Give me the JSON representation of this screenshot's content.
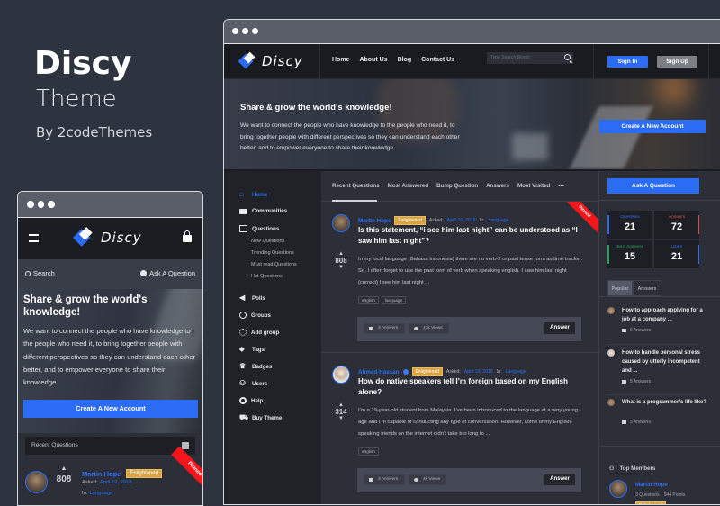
{
  "promo": {
    "title": "Discy",
    "subtitle": "Theme",
    "byline": "By 2codeThemes"
  },
  "brand": {
    "logo_text": "Discy",
    "accent": "#2c6cf5",
    "badge_color": "#d9a441",
    "pinned_color": "#f5151b"
  },
  "desktop": {
    "nav": {
      "menu": [
        "Home",
        "About Us",
        "Blog",
        "Contact Us"
      ],
      "search_placeholder": "Type Search Words",
      "sign_in": "Sign In",
      "sign_up": "Sign Up"
    },
    "hero": {
      "title": "Share & grow the world's knowledge!",
      "text": "We want to connect the people who have knowledge to the people who need it, to bring together people with different perspectives so they can understand each other better, and to empower everyone to share their knowledge.",
      "cta": "Create A New Account"
    },
    "sidebar": {
      "items": [
        {
          "label": "Home",
          "icon": "home-icon",
          "active": true
        },
        {
          "label": "Communities",
          "icon": "folder-icon"
        },
        {
          "label": "Questions",
          "icon": "book-icon"
        },
        {
          "label": "Polls",
          "icon": "megaphone-icon"
        },
        {
          "label": "Groups",
          "icon": "globe-icon"
        },
        {
          "label": "Add group",
          "icon": "add-group-icon"
        },
        {
          "label": "Tags",
          "icon": "tag-icon"
        },
        {
          "label": "Badges",
          "icon": "trophy-icon"
        },
        {
          "label": "Users",
          "icon": "users-icon"
        },
        {
          "label": "Help",
          "icon": "lifebuoy-icon"
        },
        {
          "label": "Buy Theme",
          "icon": "cart-icon"
        }
      ],
      "subitems": [
        "New Questions",
        "Trending Questions",
        "Must read Questions",
        "Hot Questions"
      ]
    },
    "tabs": [
      "Recent Questions",
      "Most Answered",
      "Bump Question",
      "Answers",
      "Most Visited",
      "•••"
    ],
    "questions": [
      {
        "author": "Martin Hope",
        "badge": "Enlightened",
        "asked_label": "Asked:",
        "date": "April 19, 2018",
        "in_label": "In:",
        "category": "Language",
        "title": "Is this statement, “i see him last night” can be understood as “I saw him last night”?",
        "body": "In my local language (Bahasa Indonesia) there are no verb-2 or past tense form as time tracker. So, I often forget to use the past form of verb when speaking english. I saw him last night (correct) I see him last night ...",
        "votes": "808",
        "tags": [
          "english",
          "language"
        ],
        "answers": "3 Answers",
        "views": "17k Views",
        "answer_button": "Answer",
        "pinned": "Pinned"
      },
      {
        "author": "Ahmed Hassan",
        "badge": "Enlightened",
        "asked_label": "Asked:",
        "date": "April 19, 2018",
        "in_label": "In:",
        "category": "Language",
        "title": "How do native speakers tell I’m foreign based on my English alone?",
        "body": "I’m a 19-year-old student from Malaysia. I’ve been introduced to the language at a very young age and I’m capable of conducting any type of conversation. However, some of my English-speaking friends on the internet didn’t take too long to ...",
        "votes": "314",
        "tags": [
          "english"
        ],
        "answers": "3 Answers",
        "views": "4k Views",
        "answer_button": "Answer"
      }
    ],
    "right": {
      "ask_button": "Ask A Question",
      "stats": [
        {
          "label": "Questions",
          "value": "21",
          "color": "#2c6cf5"
        },
        {
          "label": "Answers",
          "value": "72",
          "color": "#d9484d"
        },
        {
          "label": "Best Answers",
          "value": "15",
          "color": "#1fa45a"
        },
        {
          "label": "Users",
          "value": "21",
          "color": "#2c6cf5"
        }
      ],
      "tabs": [
        "Popular",
        "Answers"
      ],
      "popular": [
        {
          "title": "How to approach applying for a job at a company ...",
          "answers": "6 Answers"
        },
        {
          "title": "How to handle personal stress caused by utterly incompetent and ...",
          "answers": "5 Answers"
        },
        {
          "title": "What is a programmer’s life like?",
          "answers": "5 Answers"
        }
      ],
      "top_members_title": "Top Members",
      "member": {
        "name": "Martin Hope",
        "questions": "3 Questions",
        "points": "944 Points",
        "badge": "Enlightened"
      }
    }
  },
  "mobile": {
    "search_label": "Search",
    "ask_label": "Ask A Question",
    "hero": {
      "title": "Share & grow the world's knowledge!",
      "text": "We want to connect the people who have knowledge to the people who need it, to bring together people with different perspectives so they can understand each other better, and to empower everyone to share their knowledge.",
      "cta": "Create A New Account"
    },
    "select_value": "Recent Questions",
    "question": {
      "author": "Martin Hope",
      "badge": "Enlightened",
      "asked_label": "Asked:",
      "date": "April 19, 2018",
      "in_label": "In:",
      "category": "Language",
      "votes": "808",
      "pinned": "Pinned"
    }
  }
}
